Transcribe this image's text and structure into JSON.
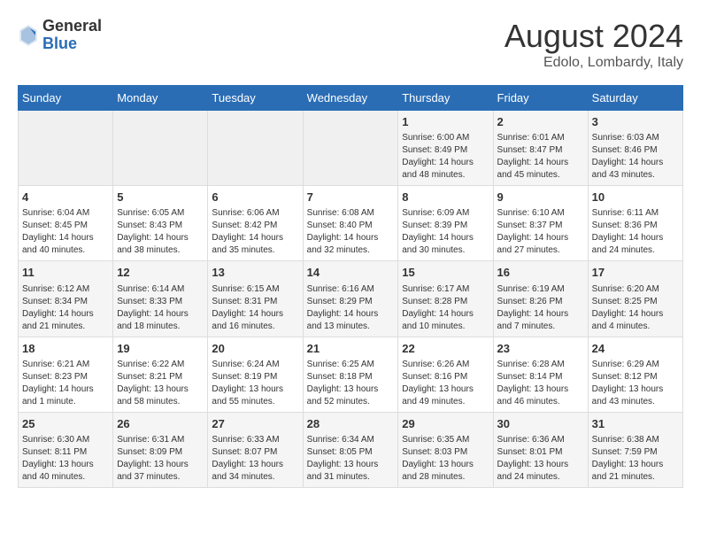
{
  "header": {
    "logo_general": "General",
    "logo_blue": "Blue",
    "main_title": "August 2024",
    "sub_title": "Edolo, Lombardy, Italy"
  },
  "days_of_week": [
    "Sunday",
    "Monday",
    "Tuesday",
    "Wednesday",
    "Thursday",
    "Friday",
    "Saturday"
  ],
  "weeks": [
    [
      {
        "day": "",
        "content": ""
      },
      {
        "day": "",
        "content": ""
      },
      {
        "day": "",
        "content": ""
      },
      {
        "day": "",
        "content": ""
      },
      {
        "day": "1",
        "content": "Sunrise: 6:00 AM\nSunset: 8:49 PM\nDaylight: 14 hours and 48 minutes."
      },
      {
        "day": "2",
        "content": "Sunrise: 6:01 AM\nSunset: 8:47 PM\nDaylight: 14 hours and 45 minutes."
      },
      {
        "day": "3",
        "content": "Sunrise: 6:03 AM\nSunset: 8:46 PM\nDaylight: 14 hours and 43 minutes."
      }
    ],
    [
      {
        "day": "4",
        "content": "Sunrise: 6:04 AM\nSunset: 8:45 PM\nDaylight: 14 hours and 40 minutes."
      },
      {
        "day": "5",
        "content": "Sunrise: 6:05 AM\nSunset: 8:43 PM\nDaylight: 14 hours and 38 minutes."
      },
      {
        "day": "6",
        "content": "Sunrise: 6:06 AM\nSunset: 8:42 PM\nDaylight: 14 hours and 35 minutes."
      },
      {
        "day": "7",
        "content": "Sunrise: 6:08 AM\nSunset: 8:40 PM\nDaylight: 14 hours and 32 minutes."
      },
      {
        "day": "8",
        "content": "Sunrise: 6:09 AM\nSunset: 8:39 PM\nDaylight: 14 hours and 30 minutes."
      },
      {
        "day": "9",
        "content": "Sunrise: 6:10 AM\nSunset: 8:37 PM\nDaylight: 14 hours and 27 minutes."
      },
      {
        "day": "10",
        "content": "Sunrise: 6:11 AM\nSunset: 8:36 PM\nDaylight: 14 hours and 24 minutes."
      }
    ],
    [
      {
        "day": "11",
        "content": "Sunrise: 6:12 AM\nSunset: 8:34 PM\nDaylight: 14 hours and 21 minutes."
      },
      {
        "day": "12",
        "content": "Sunrise: 6:14 AM\nSunset: 8:33 PM\nDaylight: 14 hours and 18 minutes."
      },
      {
        "day": "13",
        "content": "Sunrise: 6:15 AM\nSunset: 8:31 PM\nDaylight: 14 hours and 16 minutes."
      },
      {
        "day": "14",
        "content": "Sunrise: 6:16 AM\nSunset: 8:29 PM\nDaylight: 14 hours and 13 minutes."
      },
      {
        "day": "15",
        "content": "Sunrise: 6:17 AM\nSunset: 8:28 PM\nDaylight: 14 hours and 10 minutes."
      },
      {
        "day": "16",
        "content": "Sunrise: 6:19 AM\nSunset: 8:26 PM\nDaylight: 14 hours and 7 minutes."
      },
      {
        "day": "17",
        "content": "Sunrise: 6:20 AM\nSunset: 8:25 PM\nDaylight: 14 hours and 4 minutes."
      }
    ],
    [
      {
        "day": "18",
        "content": "Sunrise: 6:21 AM\nSunset: 8:23 PM\nDaylight: 14 hours and 1 minute."
      },
      {
        "day": "19",
        "content": "Sunrise: 6:22 AM\nSunset: 8:21 PM\nDaylight: 13 hours and 58 minutes."
      },
      {
        "day": "20",
        "content": "Sunrise: 6:24 AM\nSunset: 8:19 PM\nDaylight: 13 hours and 55 minutes."
      },
      {
        "day": "21",
        "content": "Sunrise: 6:25 AM\nSunset: 8:18 PM\nDaylight: 13 hours and 52 minutes."
      },
      {
        "day": "22",
        "content": "Sunrise: 6:26 AM\nSunset: 8:16 PM\nDaylight: 13 hours and 49 minutes."
      },
      {
        "day": "23",
        "content": "Sunrise: 6:28 AM\nSunset: 8:14 PM\nDaylight: 13 hours and 46 minutes."
      },
      {
        "day": "24",
        "content": "Sunrise: 6:29 AM\nSunset: 8:12 PM\nDaylight: 13 hours and 43 minutes."
      }
    ],
    [
      {
        "day": "25",
        "content": "Sunrise: 6:30 AM\nSunset: 8:11 PM\nDaylight: 13 hours and 40 minutes."
      },
      {
        "day": "26",
        "content": "Sunrise: 6:31 AM\nSunset: 8:09 PM\nDaylight: 13 hours and 37 minutes."
      },
      {
        "day": "27",
        "content": "Sunrise: 6:33 AM\nSunset: 8:07 PM\nDaylight: 13 hours and 34 minutes."
      },
      {
        "day": "28",
        "content": "Sunrise: 6:34 AM\nSunset: 8:05 PM\nDaylight: 13 hours and 31 minutes."
      },
      {
        "day": "29",
        "content": "Sunrise: 6:35 AM\nSunset: 8:03 PM\nDaylight: 13 hours and 28 minutes."
      },
      {
        "day": "30",
        "content": "Sunrise: 6:36 AM\nSunset: 8:01 PM\nDaylight: 13 hours and 24 minutes."
      },
      {
        "day": "31",
        "content": "Sunrise: 6:38 AM\nSunset: 7:59 PM\nDaylight: 13 hours and 21 minutes."
      }
    ]
  ]
}
